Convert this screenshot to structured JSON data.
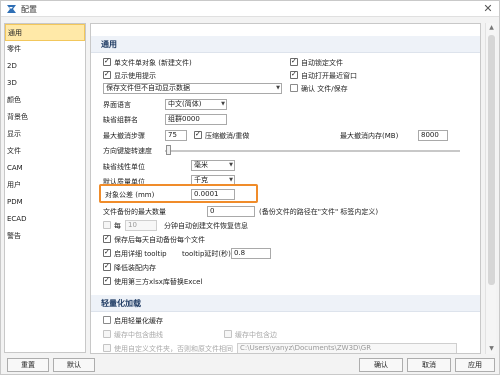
{
  "window": {
    "title": "配置"
  },
  "sidebar": {
    "items": [
      {
        "label": "通用",
        "selected": true
      },
      {
        "label": "零件"
      },
      {
        "label": "2D"
      },
      {
        "label": "3D"
      },
      {
        "label": "颜色"
      },
      {
        "label": "背景色"
      },
      {
        "label": "显示"
      },
      {
        "label": "文件"
      },
      {
        "label": "CAM"
      },
      {
        "label": "用户"
      },
      {
        "label": "PDM"
      },
      {
        "label": "ECAD"
      },
      {
        "label": "警告"
      }
    ]
  },
  "general": {
    "header": "通用",
    "single_file": "单文件单对象 (新建文件)",
    "auto_lock": "自动锁定文件",
    "show_tips": "显示使用提示",
    "auto_open_recent": "自动打开最近窗口",
    "save_mode": "保存文件但不自动显示数据",
    "confirm_file_save": "确认 文件/保存",
    "ui_language_label": "界面语言",
    "ui_language_value": "中文(简体)",
    "default_group_label": "缺省组群名",
    "default_group_value": "组群0000",
    "max_undo_label": "最大撤消步骤",
    "max_undo_value": "75",
    "compress_undo": "压缩撤消/重做",
    "max_undo_mem_label": "最大撤消内存(MB)",
    "max_undo_mem_value": "8000",
    "arrow_key_speed_label": "方向键旋转速度",
    "default_linear_unit_label": "缺省线性单位",
    "default_linear_unit_value": "毫米",
    "default_mass_unit_label": "默认质量单位",
    "default_mass_unit_value": "千克",
    "object_tolerance_label": "对象公差 (mm)",
    "object_tolerance_value": "0.0001",
    "max_backup_label": "文件备份的最大数量",
    "max_backup_value": "0",
    "max_backup_hint": "(备份文件的路径在\"文件\" 标签内定义)",
    "every_label": "每",
    "every_value": "10",
    "autosave_text": "分钟自动创建文件恢复信息",
    "save_component_copy": "保存后每天自动备份每个文件",
    "enable_tooltip": "启用详细 tooltip",
    "tooltip_delay_label": "tooltip延时(秒)",
    "tooltip_delay_value": "0.8",
    "reduce_memory": "降低装配内存",
    "use_third_party_excel": "使用第三方xlsx库替换Excel"
  },
  "lightweight": {
    "header": "轻量化加载",
    "enable_lightweight_cache": "启用轻量化缓存",
    "cache_in_component_path": "缓存中包含曲线",
    "cache_in_part": "缓存中包含边",
    "custom_folder": "使用自定义文件夹，否则和原文件相同",
    "custom_folder_path": "C:\\Users\\yanyz\\Documents\\ZW3D\\GR"
  },
  "buttons": {
    "reset": "重置",
    "default": "默认",
    "ok": "确认",
    "cancel": "取消",
    "apply": "应用"
  }
}
